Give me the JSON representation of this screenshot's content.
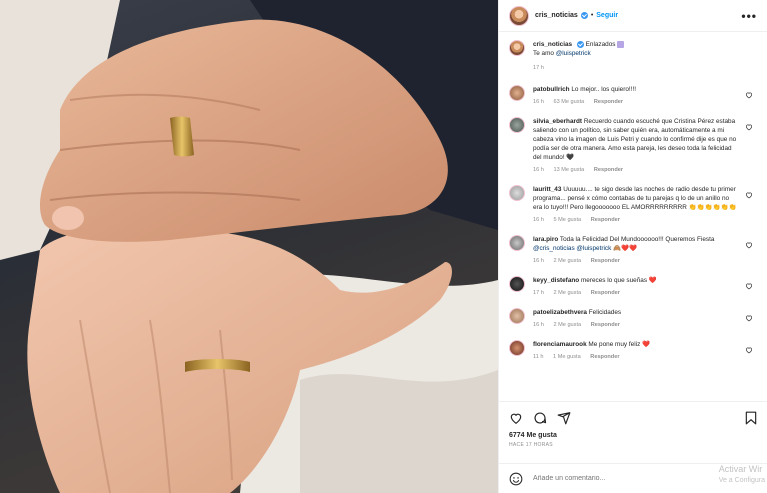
{
  "post": {
    "username": "cris_noticias",
    "follow_label": "Seguir",
    "dot": "•",
    "more": "•••"
  },
  "caption": {
    "username": "cris_noticias",
    "line1_after": "Enlazados",
    "line2_prefix": "Te amo",
    "mention": "@luispetrick",
    "time": "17 h"
  },
  "comments": [
    {
      "user": "patobullrich",
      "text": "Lo mejor.. los quiero!!!!",
      "time": "16 h",
      "likes": "63 Me gusta",
      "reply": "Responder"
    },
    {
      "user": "silvia_eberhardt",
      "text": "Recuerdo cuando escuché que Cristina Pérez estaba saliendo con un político, sin saber quién era, automáticamente a mi cabeza vino la imagen de Luis Petri y cuando lo confirmé dije es que no podía ser de otra manera. Amo esta pareja, les deseo toda la felicidad del mundo! 🖤",
      "time": "16 h",
      "likes": "13 Me gusta",
      "reply": "Responder"
    },
    {
      "user": "lauritt_43",
      "text": "Uuuuuu.... te sigo desde las noches de radio desde tu primer programa... pensé x cómo contabas de tu parejas q lo de un anillo no era lo tuyo!!! Pero llegooooooo EL AMORRRRRRRRR 👏👏👏👏👏👏",
      "time": "16 h",
      "likes": "5 Me gusta",
      "reply": "Responder"
    },
    {
      "user": "lara.piro",
      "text": "Toda la Felicidad Del Mundoooooo!!! Queremos Fiesta",
      "mention": "@cris_noticias @luispetrick",
      "emoji": "🙈❤️❤️",
      "time": "16 h",
      "likes": "2 Me gusta",
      "reply": "Responder"
    },
    {
      "user": "keyy_distefano",
      "text": "mereces lo que sueñas ❤️",
      "time": "17 h",
      "likes": "2 Me gusta",
      "reply": "Responder"
    },
    {
      "user": "patoelizabethvera",
      "text": "Felicidades",
      "time": "16 h",
      "likes": "2 Me gusta",
      "reply": "Responder"
    },
    {
      "user": "florenciamaurook",
      "text": "Me pone muy feliz ❤️",
      "time": "11 h",
      "likes": "1 Me gusta",
      "reply": "Responder"
    }
  ],
  "actions": {
    "likes": "6774 Me gusta",
    "timestamp": "HACE 17 HORAS"
  },
  "add_comment": {
    "placeholder": "Añade un comentario..."
  },
  "watermark": {
    "line1": "Activar Wir",
    "line2": "Ve a Configura"
  },
  "icons": {
    "heart": "heart-icon",
    "comment": "comment-icon",
    "share": "share-icon",
    "save": "save-icon",
    "emoji": "emoji-icon"
  },
  "colors": {
    "accent": "#0095f6",
    "verified": "#3897f0",
    "heart": "#ed4956"
  }
}
